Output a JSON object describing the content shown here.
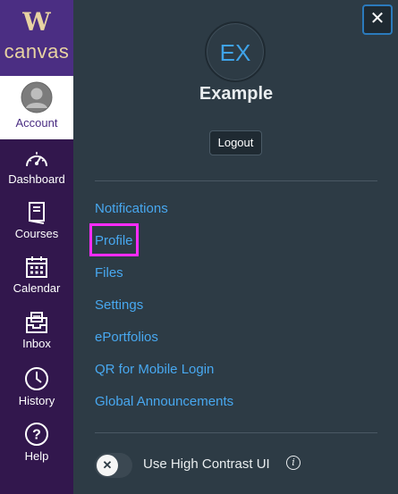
{
  "logo": {
    "mark": "W",
    "text": "canvas"
  },
  "global_nav": {
    "items": [
      {
        "label": "Account",
        "icon": "account-avatar-icon",
        "active": true
      },
      {
        "label": "Dashboard",
        "icon": "dashboard-icon"
      },
      {
        "label": "Courses",
        "icon": "courses-icon"
      },
      {
        "label": "Calendar",
        "icon": "calendar-icon"
      },
      {
        "label": "Inbox",
        "icon": "inbox-icon"
      },
      {
        "label": "History",
        "icon": "history-icon"
      },
      {
        "label": "Help",
        "icon": "help-icon"
      }
    ]
  },
  "tray": {
    "close_symbol": "✕",
    "avatar_initials": "EX",
    "user_name": "Example",
    "logout_label": "Logout",
    "links": [
      {
        "label": "Notifications"
      },
      {
        "label": "Profile",
        "highlighted": true
      },
      {
        "label": "Files"
      },
      {
        "label": "Settings"
      },
      {
        "label": "ePortfolios"
      },
      {
        "label": "QR for Mobile Login"
      },
      {
        "label": "Global Announcements"
      }
    ],
    "high_contrast": {
      "label": "Use High Contrast UI",
      "enabled": false,
      "knob_symbol": "✕",
      "info_symbol": "i"
    }
  },
  "colors": {
    "nav_bg": "#32174d",
    "logo_bg": "#4b2e83",
    "tray_bg": "#2d3b45",
    "link": "#48a8f0",
    "highlight": "#ff2bff"
  }
}
